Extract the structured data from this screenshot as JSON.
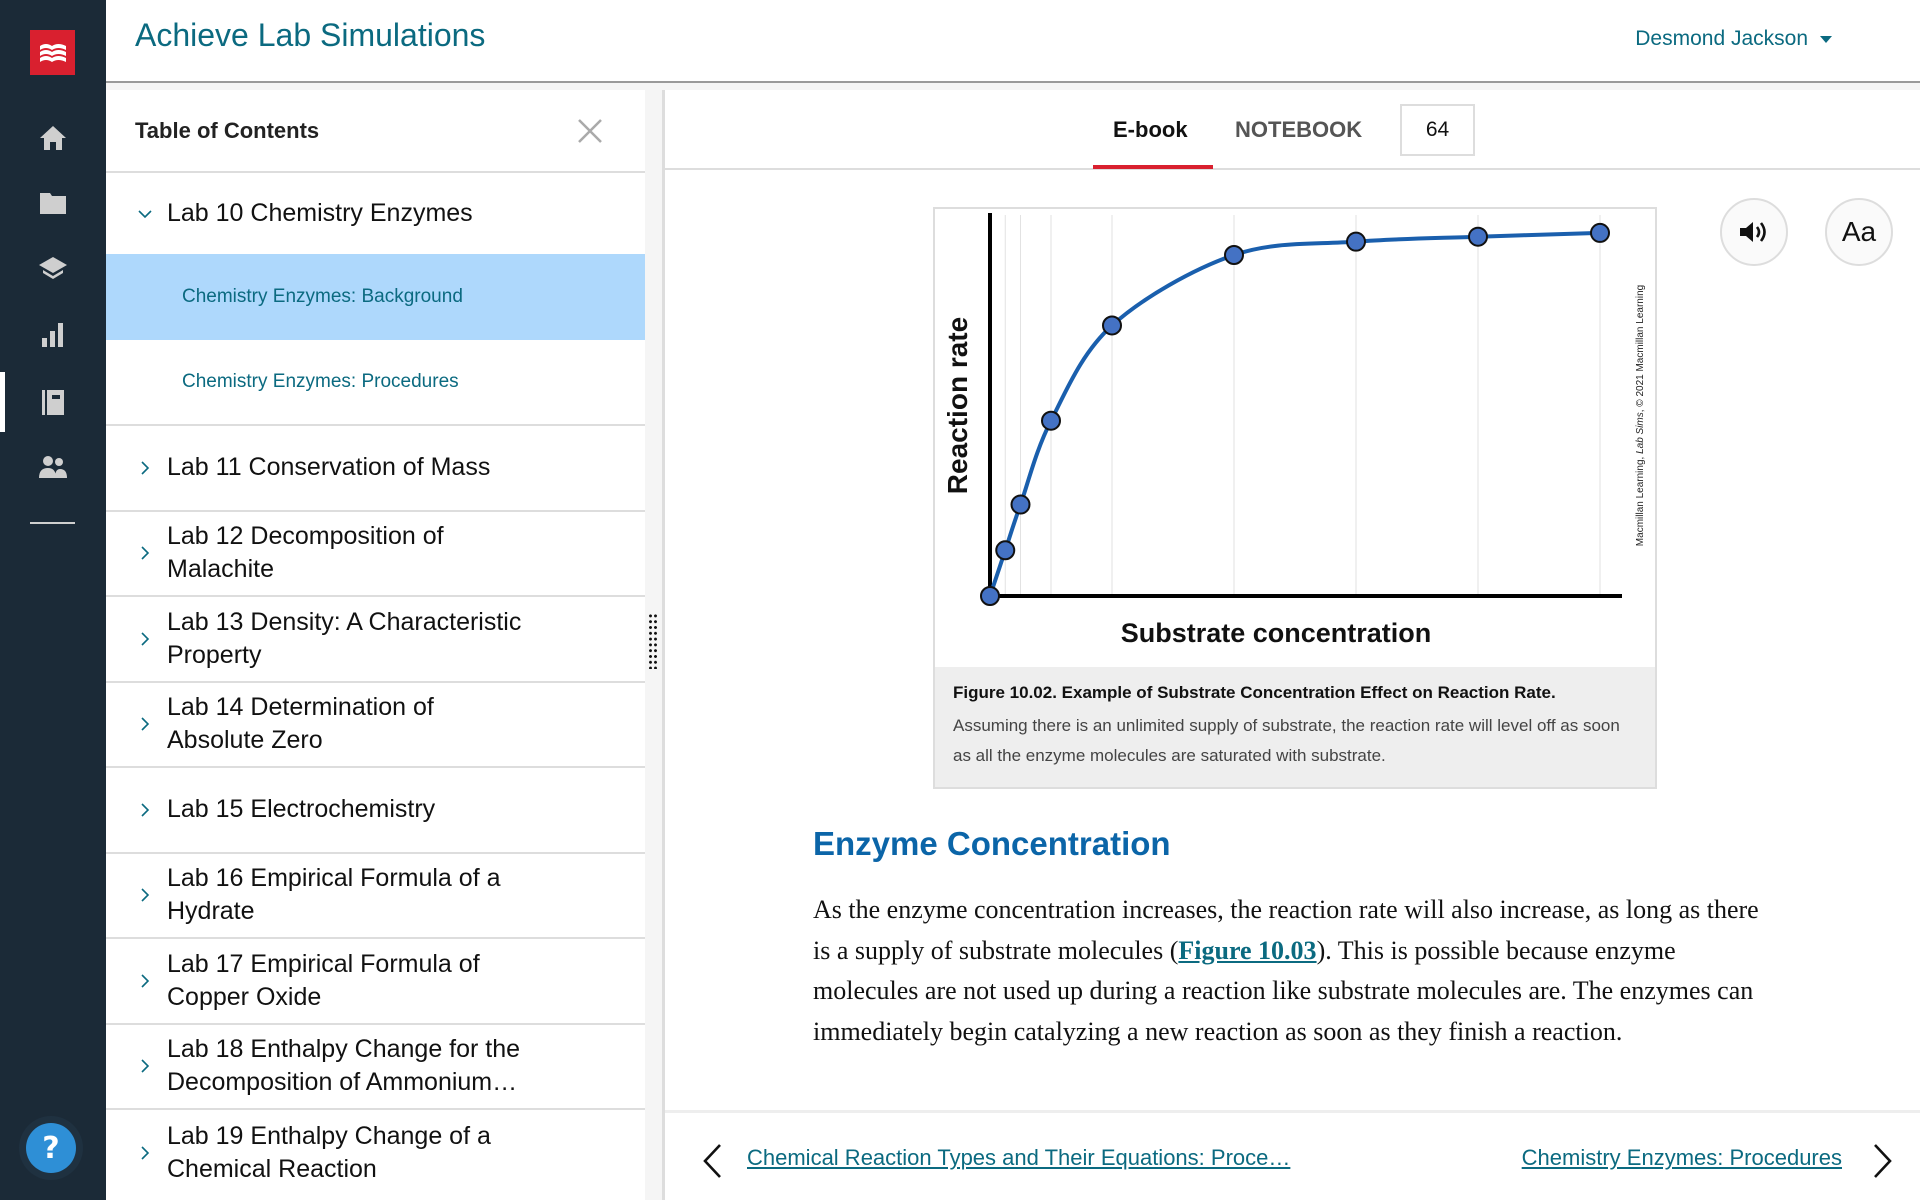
{
  "header": {
    "app_title": "Achieve Lab Simulations",
    "user_name": "Desmond Jackson"
  },
  "nav": {
    "items": [
      {
        "name": "home",
        "icon": "home-icon"
      },
      {
        "name": "resources",
        "icon": "folder-icon"
      },
      {
        "name": "courses",
        "icon": "graduation-cap-icon"
      },
      {
        "name": "gradebook",
        "icon": "bar-chart-icon"
      },
      {
        "name": "ebook",
        "icon": "notebook-icon",
        "active": true
      },
      {
        "name": "people",
        "icon": "users-icon"
      }
    ],
    "help_label": "?"
  },
  "toc": {
    "title": "Table of Contents",
    "items": [
      {
        "label": "Lab 10 Chemistry Enzymes",
        "expanded": true,
        "children": [
          {
            "label": "Chemistry Enzymes: Background",
            "selected": true
          },
          {
            "label": "Chemistry Enzymes: Procedures",
            "selected": false
          }
        ]
      },
      {
        "label": "Lab 11 Conservation of Mass"
      },
      {
        "label": "Lab 12 Decomposition of Malachite"
      },
      {
        "label": "Lab 13 Density: A Characteristic Property"
      },
      {
        "label": "Lab 14 Determination of Absolute Zero"
      },
      {
        "label": "Lab 15 Electrochemistry"
      },
      {
        "label": "Lab 16 Empirical Formula of a Hydrate"
      },
      {
        "label": "Lab 17 Empirical Formula of Copper Oxide"
      },
      {
        "label": "Lab 18 Enthalpy Change for the Decomposition of Ammonium…"
      },
      {
        "label": "Lab 19 Enthalpy Change of a Chemical Reaction"
      }
    ]
  },
  "main": {
    "tabs": [
      {
        "label": "E-book",
        "active": true
      },
      {
        "label": "NOTEBOOK",
        "active": false
      }
    ],
    "page_number": "64",
    "font_button_label": "Aa",
    "figure": {
      "title": "Figure 10.02. Example of Substrate Concentration Effect on Reaction Rate.",
      "caption": "Assuming there is an unlimited supply of substrate, the reaction rate will level off as soon as all the enzyme molecules are saturated with substrate.",
      "credit_prefix": "Macmillan Learning, ",
      "credit_italic": "Lab Sims",
      "credit_suffix": ", © 2021 Macmillan Learning"
    },
    "section_heading": "Enzyme Concentration",
    "paragraph_before_link": "As the enzyme concentration increases, the reaction rate will also increase, as long as there is a supply of substrate molecules (",
    "paragraph_link": "Figure 10.03",
    "paragraph_after_link": "). This is possible because enzyme molecules are not used up during a reaction like substrate molecules are. The enzymes can immediately begin catalyzing a new reaction as soon as they finish a reaction.",
    "prev_link": "Chemical Reaction Types and Their Equations: Proce…",
    "next_link": "Chemistry Enzymes: Procedures"
  },
  "chart_data": {
    "type": "line",
    "title": "",
    "xlabel": "Substrate concentration",
    "ylabel": "Reaction rate",
    "x": [
      0,
      2.5,
      5,
      10,
      20,
      40,
      60,
      80,
      100
    ],
    "series": [
      {
        "name": "Reaction rate",
        "values": [
          0,
          12,
          24,
          46,
          71,
          89.5,
          93,
          94.3,
          95.3
        ],
        "color": "#1a5fad",
        "marker_color": "#4472c4"
      }
    ],
    "xlim": [
      0,
      100
    ],
    "ylim": [
      0,
      100
    ],
    "vertical_gridlines_at": [
      2.5,
      5,
      10,
      20,
      40,
      60,
      80,
      100
    ],
    "grid": true,
    "tick_labels": false,
    "smooth": true
  },
  "colors": {
    "brand_red": "#d9202f",
    "nav_bg": "#1b2a37",
    "link_teal": "#0b6a80",
    "heading_blue": "#0b65a8",
    "selected_bg": "#aed8fc"
  }
}
